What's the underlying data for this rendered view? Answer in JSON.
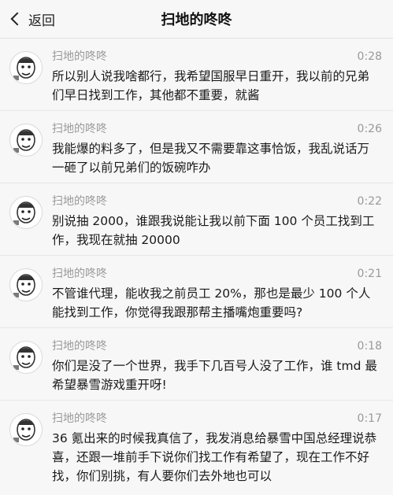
{
  "header": {
    "back_label": "返回",
    "title": "扫地的咚咚"
  },
  "messages": [
    {
      "sender": "扫地的咚咚",
      "time": "0:28",
      "text": "所以别人说我啥都行，我希望国服早日重开，我以前的兄弟们早日找到工作，其他都不重要，就酱"
    },
    {
      "sender": "扫地的咚咚",
      "time": "0:26",
      "text": "我能爆的料多了，但是我又不需要靠这事恰饭，我乱说话万一砸了以前兄弟们的饭碗咋办"
    },
    {
      "sender": "扫地的咚咚",
      "time": "0:22",
      "text": "别说抽 2000，谁跟我说能让我以前下面 100 个员工找到工作，我现在就抽 20000"
    },
    {
      "sender": "扫地的咚咚",
      "time": "0:21",
      "text": "不管谁代理，能收我之前员工 20%，那也是最少 100 个人能找到工作，你觉得我跟那帮主播嘴炮重要吗?"
    },
    {
      "sender": "扫地的咚咚",
      "time": "0:18",
      "text": "你们是没了一个世界，我手下几百号人没了工作，谁 tmd 最希望暴雪游戏重开呀!"
    },
    {
      "sender": "扫地的咚咚",
      "time": "0:17",
      "text": "36 氪出来的时候我真信了，我发消息给暴雪中国总经理说恭喜，还跟一堆前手下说你们找工作有希望了，现在工作不好找，你们别挑，有人要你们去外地也可以"
    }
  ]
}
